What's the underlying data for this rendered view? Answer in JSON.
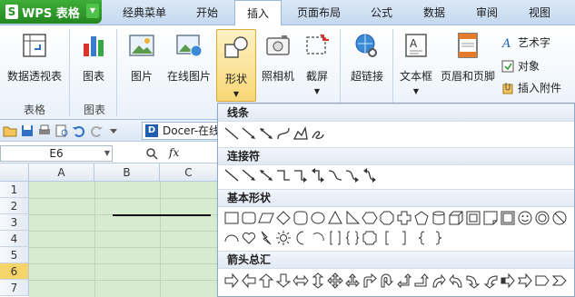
{
  "app": {
    "name": "WPS 表格",
    "logo_letter": "S"
  },
  "menu": {
    "tabs": [
      {
        "label": "经典菜单"
      },
      {
        "label": "开始"
      },
      {
        "label": "插入"
      },
      {
        "label": "页面布局"
      },
      {
        "label": "公式"
      },
      {
        "label": "数据"
      },
      {
        "label": "审阅"
      },
      {
        "label": "视图"
      }
    ],
    "active_tab": "插入"
  },
  "ribbon": {
    "buttons": [
      {
        "label": "数据透视表",
        "icon": "pivot-table-icon"
      },
      {
        "label": "图表",
        "icon": "chart-icon"
      },
      {
        "label": "图片",
        "icon": "picture-icon"
      },
      {
        "label": "在线图片",
        "icon": "online-picture-icon"
      },
      {
        "label": "形状",
        "icon": "shapes-icon"
      },
      {
        "label": "照相机",
        "icon": "camera-icon"
      },
      {
        "label": "截屏",
        "icon": "screenshot-icon"
      },
      {
        "label": "超链接",
        "icon": "hyperlink-icon"
      },
      {
        "label": "文本框",
        "icon": "textbox-icon"
      },
      {
        "label": "页眉和页脚",
        "icon": "header-footer-icon"
      }
    ],
    "small_buttons": [
      {
        "label": "艺术字",
        "icon": "wordart-icon"
      },
      {
        "label": "对象",
        "icon": "object-icon"
      },
      {
        "label": "插入附件",
        "icon": "attachment-icon"
      }
    ],
    "groups": [
      {
        "label": "表格"
      },
      {
        "label": "图表"
      }
    ]
  },
  "quick_access": {
    "doc_tab": "Docer-在线"
  },
  "formula_bar": {
    "cell_ref": "E6",
    "fx_label": "fx"
  },
  "sheet": {
    "columns": [
      "A",
      "B",
      "C"
    ],
    "rows": [
      "1",
      "2",
      "3",
      "4",
      "5",
      "6",
      "7"
    ],
    "selected_row": "6",
    "cell_fill": "#d6ebcf"
  },
  "shapes_panel": {
    "sections": [
      {
        "title": "线条"
      },
      {
        "title": "连接符"
      },
      {
        "title": "基本形状"
      },
      {
        "title": "箭头总汇"
      }
    ]
  },
  "colors": {
    "accent": "#f8d776",
    "wps_green": "#2a8f25",
    "selection_row": "#f5d46a"
  }
}
